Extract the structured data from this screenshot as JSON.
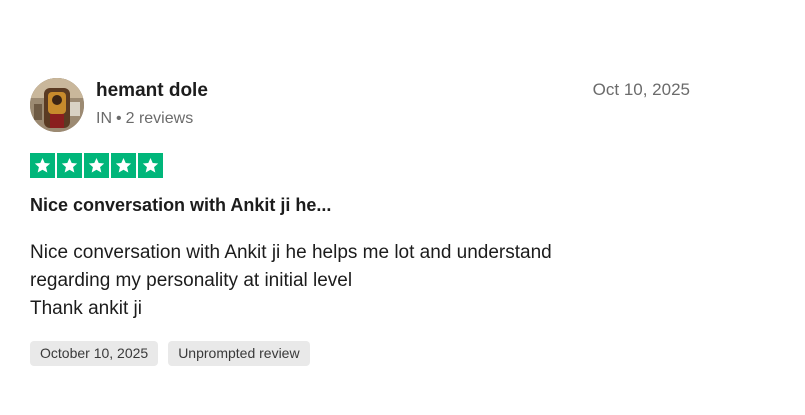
{
  "reviewer": {
    "name": "hemant dole",
    "country": "IN",
    "separator": "•",
    "review_count": "2 reviews",
    "avatar_icon": "user-photo-icon"
  },
  "review": {
    "date": "Oct 10, 2025",
    "rating": 5,
    "rating_max": 5,
    "star_color": "#00b67a",
    "title": "Nice conversation with Ankit ji he...",
    "body_lines": [
      "Nice conversation with Ankit ji he helps me lot and understand",
      "regarding my personality at initial level",
      "Thank ankit ji"
    ],
    "tags": {
      "experience_date": "October 10, 2025",
      "review_type": "Unprompted review"
    }
  }
}
